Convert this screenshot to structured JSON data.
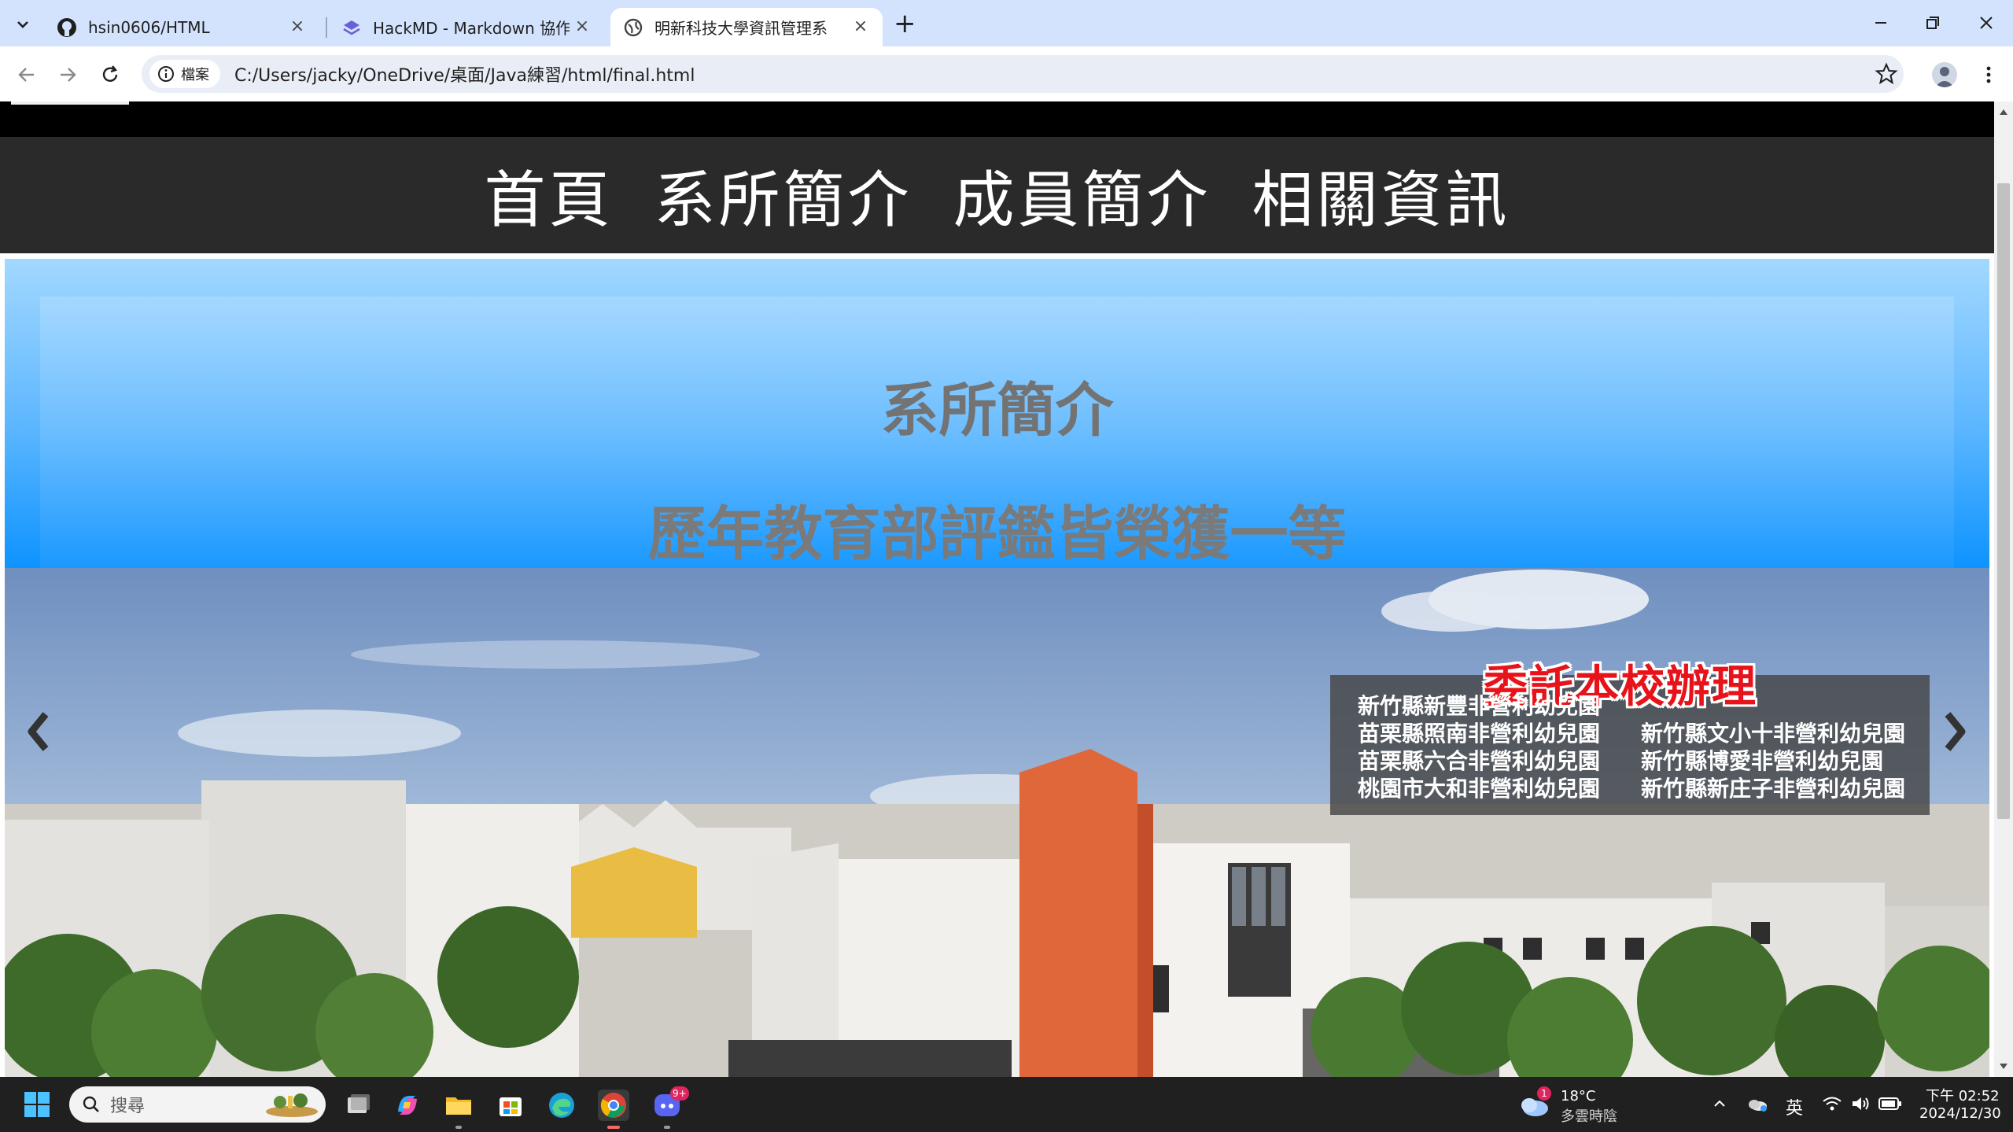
{
  "browser": {
    "tabs": [
      {
        "title": "hsin0606/HTML",
        "icon": "github-icon"
      },
      {
        "title": "HackMD - Markdown 協作知識",
        "icon": "hackmd-icon"
      },
      {
        "title": "明新科技大學資訊管理系",
        "icon": "globe-icon",
        "active": true
      }
    ],
    "new_tab": "+",
    "site_info_label": "檔案",
    "url": "C:/Users/jacky/OneDrive/桌面/Java練習/html/final.html"
  },
  "page": {
    "nav": [
      "首頁",
      "系所簡介",
      "成員簡介",
      "相關資訊"
    ],
    "intro": {
      "title": "系所簡介",
      "subtitle": "歷年教育部評鑑皆榮獲一等"
    },
    "carousel": {
      "banner_title": "委託本校辦理",
      "schools_left": [
        "新竹縣新豐非營利幼兒園",
        "苗栗縣照南非營利幼兒園",
        "苗栗縣六合非營利幼兒園",
        "桃園市大和非營利幼兒園"
      ],
      "schools_right": [
        "新竹縣文小十非營利幼兒園",
        "新竹縣博愛非營利幼兒園",
        "新竹縣新庄子非營利幼兒園"
      ],
      "prev": "‹",
      "next": "›"
    }
  },
  "taskbar": {
    "search_placeholder": "搜尋",
    "weather_temp": "18°C",
    "weather_desc": "多雲時陰",
    "weather_badge": "1",
    "ime": "英",
    "time": "下午 02:52",
    "date": "2024/12/30",
    "discord_badge": "9+"
  },
  "colors": {
    "tabbar_bg": "#d3e3fd",
    "nav_bg": "#2a2a2a",
    "intro_top": "#a3d8ff",
    "intro_bottom": "#0e93ff",
    "banner_red": "#e8131a"
  }
}
